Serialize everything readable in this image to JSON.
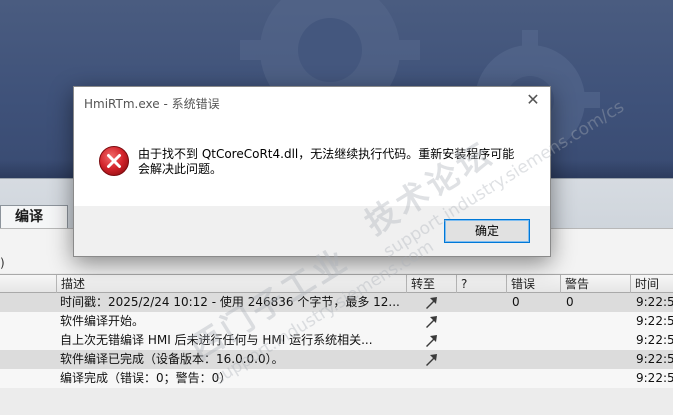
{
  "dialog": {
    "title": "HmiRTm.exe - 系统错误",
    "close_glyph": "✕",
    "message": "由于找不到 QtCoreCoRt4.dll，无法继续执行代码。重新安装程序可能会解决此问题。",
    "ok_label": "确定",
    "icon": "error-icon"
  },
  "tab": {
    "label": "编译"
  },
  "filter": {
    "paren": ")"
  },
  "table": {
    "columns": [
      "描述",
      "转至",
      "?",
      "错误",
      "警告",
      "时间"
    ],
    "rows": [
      {
        "desc": "时间戳：2025/2/24 10:12 - 使用 246836 个字节，最多 12...",
        "goto": true,
        "errors": "0",
        "warnings": "0",
        "time": "9:22:5"
      },
      {
        "desc": "软件编译开始。",
        "goto": true,
        "errors": "",
        "warnings": "",
        "time": "9:22:5"
      },
      {
        "desc": "自上次无错编译 HMI 后未进行任何与 HMI 运行系统相关...",
        "goto": true,
        "errors": "",
        "warnings": "",
        "time": "9:22:5"
      },
      {
        "desc": "软件编译已完成（设备版本：16.0.0.0）。",
        "goto": true,
        "errors": "",
        "warnings": "",
        "time": "9:22:5"
      },
      {
        "desc": "编译完成（错误：0；警告：0）",
        "goto": false,
        "errors": "",
        "warnings": "",
        "time": "9:22:5"
      }
    ]
  },
  "watermark": {
    "brand": "西门子工业",
    "forum": "技术论坛",
    "url1": "support.industry.siemens.com",
    "url2": "support.industry.siemens.com/cs"
  },
  "colors": {
    "banner": "#3f527a",
    "accent": "#0078d7",
    "error_red": "#d2232a"
  }
}
